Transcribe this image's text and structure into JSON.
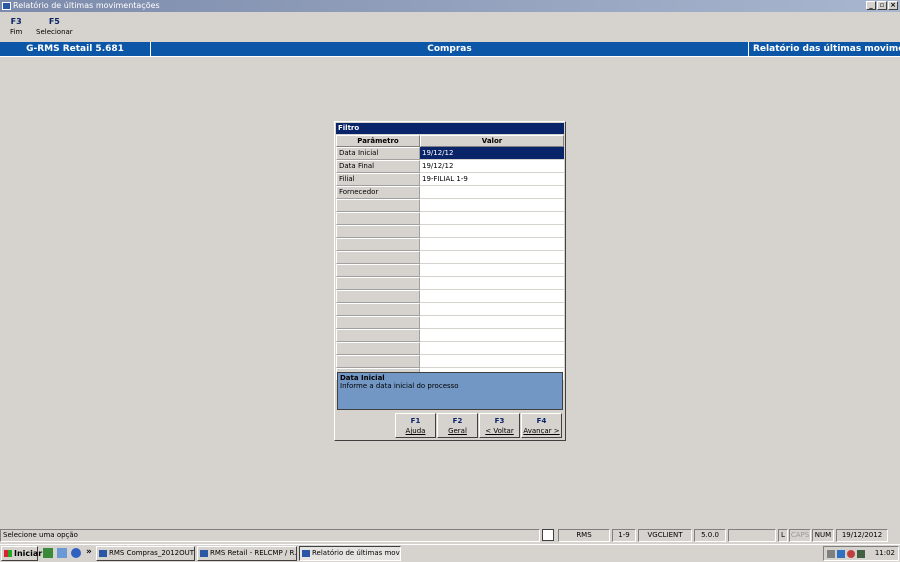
{
  "window": {
    "title": "Relatório de últimas movimentações"
  },
  "fkeys": [
    {
      "key": "F3",
      "label": "Fim"
    },
    {
      "key": "F5",
      "label": "Selecionar"
    }
  ],
  "header": {
    "app_version": "G-RMS Retail 5.681",
    "module": "Compras",
    "report": "Relatório das últimas movimentações"
  },
  "dialog": {
    "title": "Filtro",
    "columns": {
      "param": "Parâmetro",
      "value": "Valor"
    },
    "rows": [
      {
        "param": "Data Inicial",
        "value": "19/12/12"
      },
      {
        "param": "Data Final",
        "value": "19/12/12"
      },
      {
        "param": "Filial",
        "value": "19-FILIAL 1-9"
      },
      {
        "param": "Fornecedor",
        "value": ""
      }
    ],
    "help": {
      "title": "Data Inicial",
      "text": "Informe a data inicial do processo"
    },
    "buttons": [
      {
        "key": "F1",
        "label": "Ajuda"
      },
      {
        "key": "F2",
        "label": "Geral"
      },
      {
        "key": "F3",
        "label": "< Voltar"
      },
      {
        "key": "F4",
        "label": "Avançar >"
      }
    ]
  },
  "statusbar": {
    "message": "Selecione uma opção",
    "system": "RMS",
    "branch": "1-9",
    "client": "VGCLIENT",
    "version": "5.0.0",
    "l": "L",
    "caps": "CAPS",
    "num": "NUM",
    "date": "19/12/2012"
  },
  "taskbar": {
    "start": "Iniciar",
    "chevron": "»",
    "tasks": [
      "RMS Compras_2012OUT...",
      "RMS Retail - RELCMP / R...",
      "Relatório de últimas movi..."
    ],
    "clock": "11:02"
  }
}
